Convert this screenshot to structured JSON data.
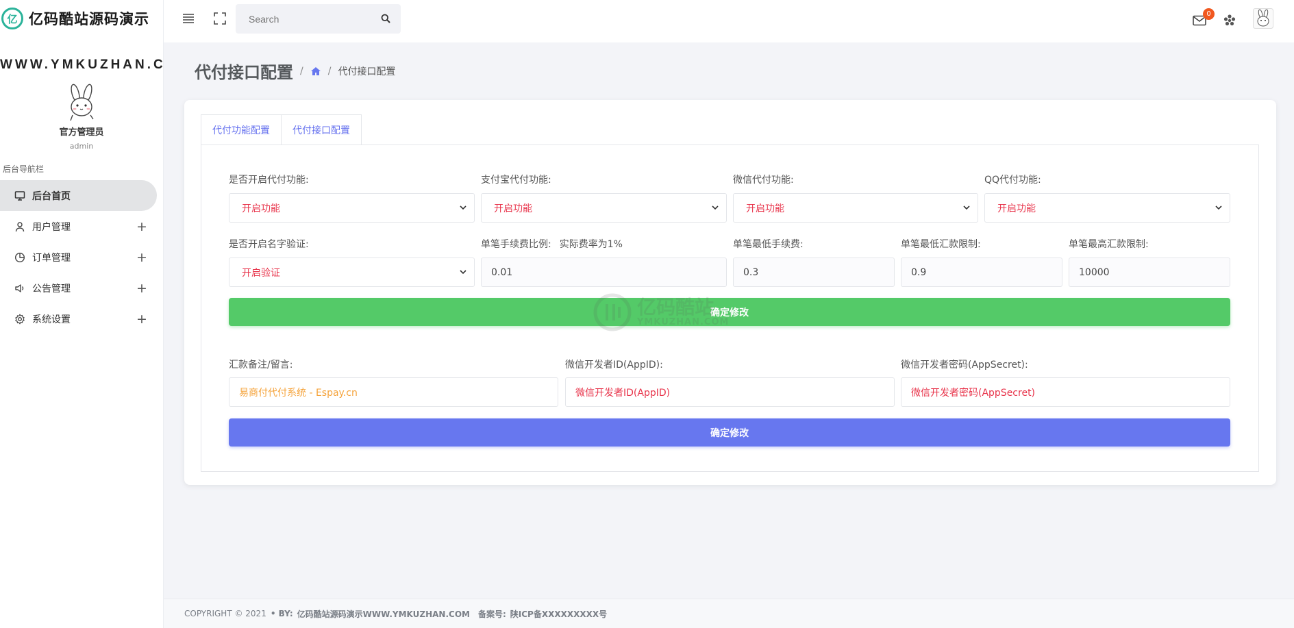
{
  "brand": {
    "logo_glyph": "亿",
    "name": "亿码酷站源码演示"
  },
  "site_url": "WWW.YMKUZHAN.COM",
  "profile": {
    "name": "官方管理员",
    "role": "admin"
  },
  "sidebar": {
    "title": "后台导航栏",
    "items": [
      {
        "label": "后台首页",
        "icon": "monitor-icon",
        "active": true
      },
      {
        "label": "用户管理",
        "icon": "user-icon",
        "expandable": "+"
      },
      {
        "label": "订单管理",
        "icon": "pie-chart-icon",
        "expandable": "+"
      },
      {
        "label": "公告管理",
        "icon": "speaker-icon",
        "expandable": "+"
      },
      {
        "label": "系统设置",
        "icon": "gear-icon",
        "expandable": "+"
      }
    ]
  },
  "topbar": {
    "search_placeholder": "Search",
    "mail_badge": "0"
  },
  "page": {
    "title": "代付接口配置",
    "breadcrumb_sep": "/",
    "breadcrumb_current": "代付接口配置"
  },
  "tabs": [
    "代付功能配置",
    "代付接口配置"
  ],
  "form1": {
    "row1": [
      {
        "label": "是否开启代付功能:",
        "value": "开启功能"
      },
      {
        "label": "支付宝代付功能:",
        "value": "开启功能"
      },
      {
        "label": "微信代付功能:",
        "value": "开启功能"
      },
      {
        "label": "QQ代付功能:",
        "value": "开启功能"
      }
    ],
    "row2_select": {
      "label": "是否开启名字验证:",
      "value": "开启验证"
    },
    "row2_inputs": [
      {
        "label": "单笔手续费比例:",
        "hint": "实际费率为1%",
        "value": "0.01"
      },
      {
        "label": "单笔最低手续费:",
        "value": "0.3"
      },
      {
        "label": "单笔最低汇款限制:",
        "value": "0.9"
      },
      {
        "label": "单笔最高汇款限制:",
        "value": "10000"
      }
    ],
    "submit": "确定修改"
  },
  "form2": {
    "fields": [
      {
        "label": "汇款备注/留言:",
        "value": "易商付代付系统 - Espay.cn"
      },
      {
        "label": "微信开发者ID(AppID):",
        "value": "微信开发者ID(AppID)"
      },
      {
        "label": "微信开发者密码(AppSecret):",
        "value": "微信开发者密码(AppSecret)"
      }
    ],
    "submit": "确定修改"
  },
  "watermark": {
    "cn": "亿码酷站",
    "en": "YMKUZHAN.COM"
  },
  "footer": {
    "copyright": "COPYRIGHT © 2021",
    "by_label": "• BY:",
    "by_value": "亿码酷站源码演示WWW.YMKUZHAN.COM",
    "icp_label": "备案号:",
    "icp_value": "陕ICP备XXXXXXXXX号"
  },
  "colors": {
    "accent": "#6777ef",
    "success": "#54ca68",
    "danger": "#e8344b",
    "warning": "#f5a33b",
    "brand_teal": "#2bb39a"
  }
}
